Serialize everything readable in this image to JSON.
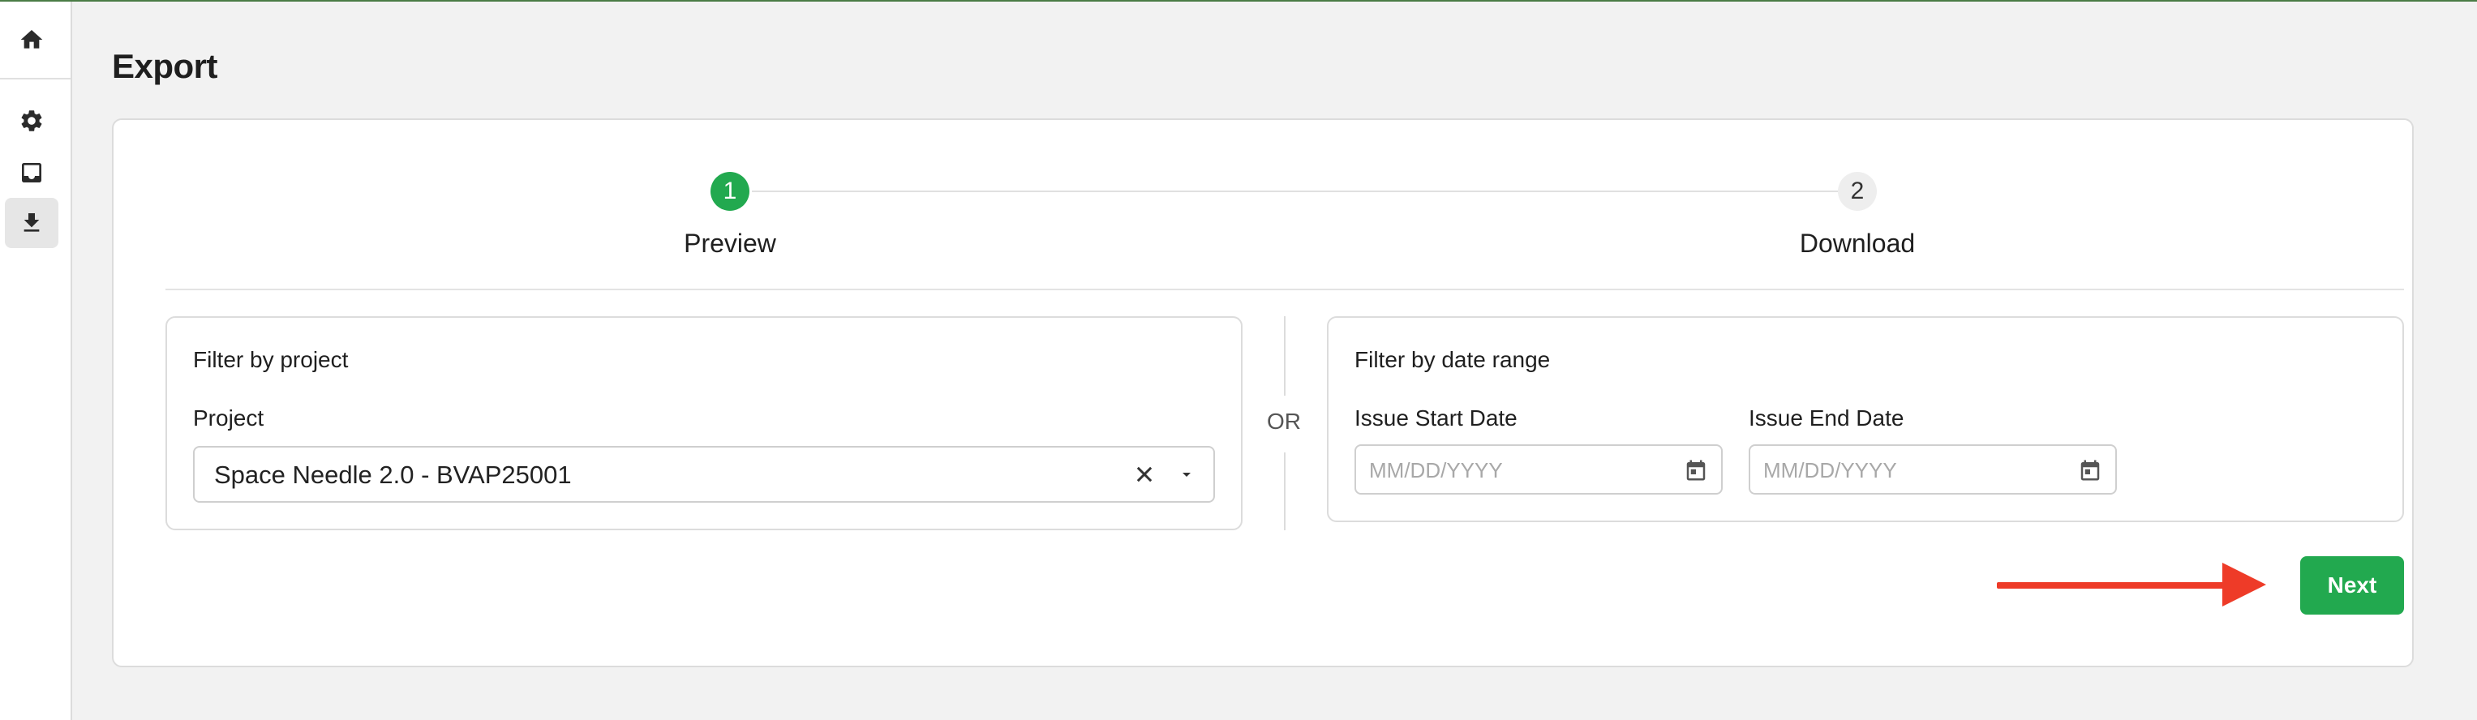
{
  "page": {
    "title": "Export"
  },
  "sidebar": {
    "items": [
      {
        "name": "home",
        "icon": "home-icon"
      },
      {
        "name": "settings",
        "icon": "gear-icon"
      },
      {
        "name": "inbox",
        "icon": "inbox-icon"
      },
      {
        "name": "export",
        "icon": "download-icon",
        "active": true
      }
    ]
  },
  "stepper": {
    "steps": [
      {
        "number": "1",
        "label": "Preview",
        "state": "active"
      },
      {
        "number": "2",
        "label": "Download",
        "state": "pending"
      }
    ]
  },
  "project_filter": {
    "title": "Filter by project",
    "field_label": "Project",
    "value": "Space Needle 2.0 - BVAP25001"
  },
  "separator": {
    "label": "OR"
  },
  "date_filter": {
    "title": "Filter by date range",
    "start": {
      "label": "Issue Start Date",
      "placeholder": "MM/DD/YYYY"
    },
    "end": {
      "label": "Issue End Date",
      "placeholder": "MM/DD/YYYY"
    }
  },
  "actions": {
    "next_label": "Next"
  },
  "colors": {
    "accent": "#22a94f",
    "annotation_arrow": "#ee3b28"
  }
}
